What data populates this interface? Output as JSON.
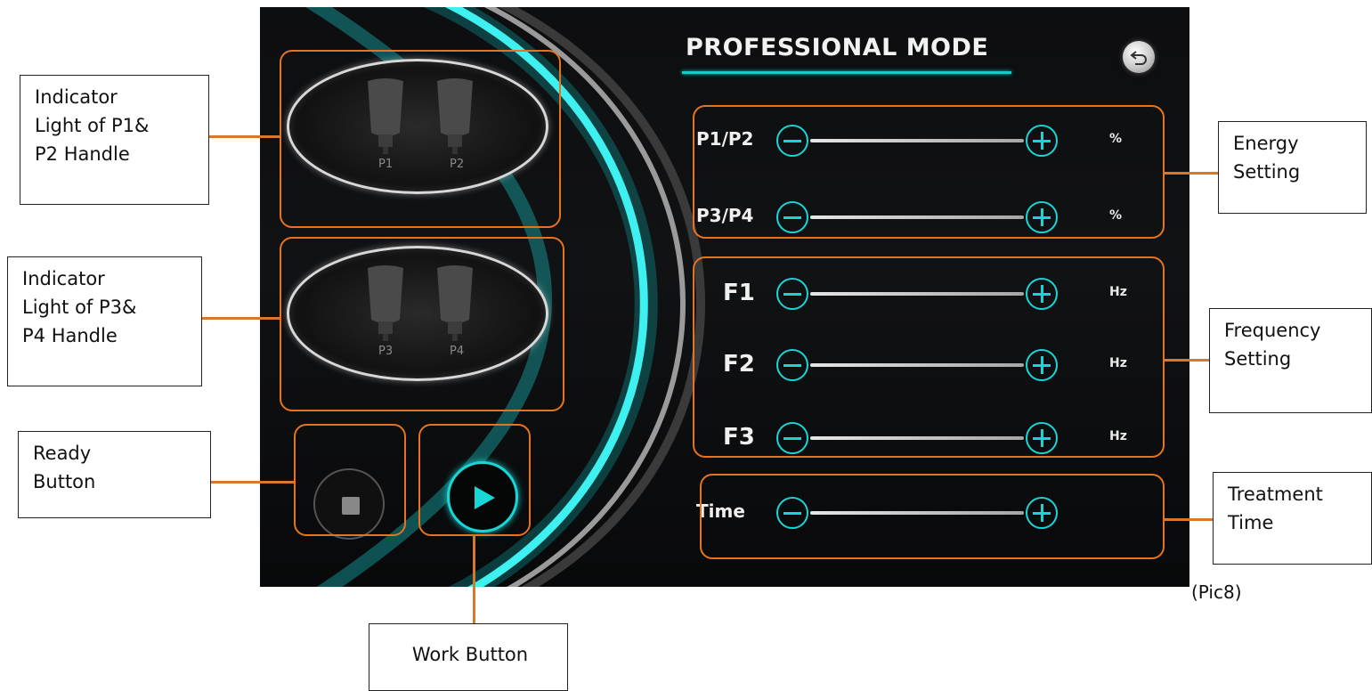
{
  "screen": {
    "title": "PROFESSIONAL MODE",
    "back_icon": "back-arrow-icon",
    "handles_top": [
      "P1",
      "P2"
    ],
    "handles_bottom": [
      "P3",
      "P4"
    ],
    "energy_rows": [
      {
        "label": "P1/P2",
        "unit": "%"
      },
      {
        "label": "P3/P4",
        "unit": "%"
      }
    ],
    "frequency_rows": [
      {
        "label": "F1",
        "unit": "Hz"
      },
      {
        "label": "F2",
        "unit": "Hz"
      },
      {
        "label": "F3",
        "unit": "Hz"
      }
    ],
    "time_row": {
      "label": "Time"
    },
    "accent_color": "#19d6d6",
    "callout_color": "#e8731e"
  },
  "annotations": {
    "indicator_p1p2": [
      "Indicator",
      "Light of P1&",
      "P2 Handle"
    ],
    "indicator_p3p4": [
      "Indicator",
      "Light of P3&",
      "P4 Handle"
    ],
    "ready_button": [
      "Ready",
      "Button"
    ],
    "work_button": [
      "Work Button"
    ],
    "energy_setting": [
      "Energy",
      "Setting"
    ],
    "frequency_setting": [
      "Frequency",
      "Setting"
    ],
    "treatment_time": [
      "Treatment",
      "Time"
    ],
    "pic_caption": "(Pic8)"
  }
}
